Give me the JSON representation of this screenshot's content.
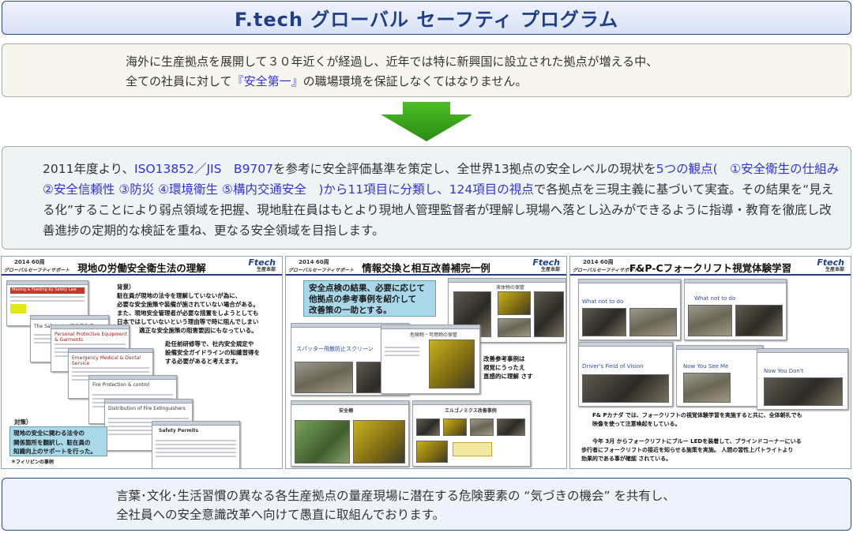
{
  "title": "F.tech グローバル セーフティ プログラム",
  "intro": {
    "line1": "海外に生産拠点を展開して３０年近くが経過し、近年では特に新興国に設立された拠点が増える中、",
    "line2_pre": "全ての社員に対して",
    "line2_highlight": "『安全第一』",
    "line2_post": "の職場環境を保証しなくてはなりません。"
  },
  "arrow_icon": "down-arrow-icon",
  "description": {
    "s1": "2011年度より、",
    "s2": "ISO13852／JIS　B9707",
    "s3": "を参考に安全評価基準を策定し、全世界13拠点の安全レベルの現状を",
    "s4": "5つの観点",
    "s5": "(　①安全衛生の仕組み ②安全信頼性 ③防災 ④環境衛生 ⑤構内交通安全　)から11項目に分類し、124項目の視点",
    "s6": "で各拠点を三現主義に基づいて実査。その結果を“見える化”することにより弱点領域を把握、現地駐在員はもとより現地人管理監督者が理解し現場へ落とし込みができるように指導・教育を徹底し改善進捗の定期的な検証を重ね、更なる安全領域を目指します。"
  },
  "panel_common": {
    "year": "2014 60周",
    "header_sub": "グローバルセーフティサポート",
    "logo": "Ftech",
    "logo_sub": "生産本部"
  },
  "panel1": {
    "title": "現地の労働安全衛生法の理解",
    "bg_heading": "背景）",
    "bg_text": [
      "駐在員が現地の法令を理解していないが為に、",
      "必要な安全施策や装備が施されていない場合がある。",
      "また、現地安全管理者が必要な措置をしようとしても",
      "日本ではしていないという理由等で時に阻んでしまい",
      "適正な安全施策の阻害要因にもなっている。"
    ],
    "note_text": [
      "赴任前研修等で、社内安全規定や",
      "設備安全ガイドラインの知識習得を",
      "する必要があると考えます。"
    ],
    "sol_heading": "対策）",
    "solution": [
      "現地の安全に関わる法令の",
      "関係箇所を翻訳し、駐在員の",
      "知識向上のサポートを行った。"
    ],
    "example": "＊フィリピンの事例",
    "doc_labels": [
      "Moving & Feeding by Safety Law",
      "The Safety Act 安全衛生法",
      "Personal Protective Equipment & Garments",
      "Emergency Medical & Dental Service",
      "Fire Protection & control",
      "Distribution of Fire Extinguishers",
      "Safety Permits"
    ]
  },
  "panel2": {
    "title": "情報交換と相互改善補完一例",
    "lead": [
      "安全点検の結果、必要に応じて",
      "他拠点の参考事例を紹介して",
      "改善策の一助とする。"
    ],
    "doc_label_top": "危険物・可燃物の保管",
    "doc_label_left": "スパッター飛散防止スクリーン",
    "doc_label_bl": "安全柵",
    "doc_label_br": "エルゴノミクス改善事例",
    "right_note": [
      "改善参考事例は",
      "視覚にうったえ",
      "直感的に理解 さす"
    ]
  },
  "panel3": {
    "title": "F&P-Cフォークリフト視覚体験学習",
    "labels": [
      "What not to do",
      "What not to do",
      "Driver's Field of Vision",
      "Now You See Me",
      "Now You Don't"
    ],
    "text": [
      "F& Pカナダ では、フォークリフトの視覚体験学習を実施すると共に、全体朝礼でも",
      "映像を使って注意喚起をしている。",
      "",
      "今年 3月 からフォークリフトにブルー LEDを装着して、ブラインドコーナーにいる",
      "歩行者にフォークリフトの接近を知らせる施策を実施。 人間の習性上パトライトより",
      "効果的である事が確認 されている。"
    ]
  },
  "footer": {
    "line1": "言葉･文化･生活習慣の異なる各生産拠点の量産現場に潜在する危険要素の “気づきの機会” を共有し、",
    "line2": "全社員への安全意識改革へ向けて愚直に取組んでおります。"
  },
  "colors": {
    "accent": "#1f3f86",
    "highlight": "#3434d6",
    "arrow": "#2f9a18"
  }
}
